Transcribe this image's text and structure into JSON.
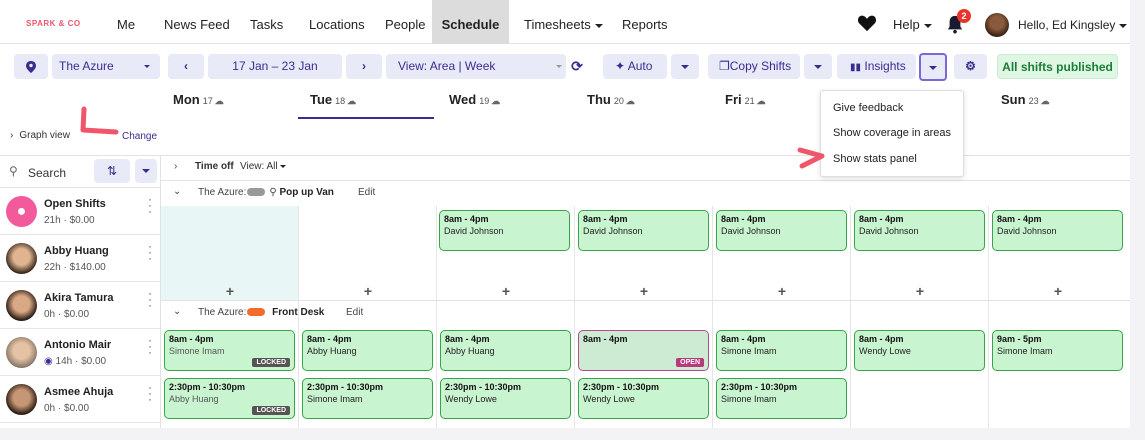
{
  "brand": "SPARK & CO",
  "nav": {
    "items": [
      "Me",
      "News Feed",
      "Tasks",
      "Locations",
      "People",
      "Schedule",
      "Timesheets",
      "Reports"
    ],
    "help": "Help",
    "notifications_count": "2",
    "greeting": "Hello, Ed Kingsley"
  },
  "toolbar": {
    "location": "The Azure",
    "date_range": "17 Jan – 23 Jan",
    "view": "View: Area |  Week",
    "auto": "Auto",
    "copy_shifts": "Copy Shifts",
    "insights": "Insights",
    "published": "All shifts published"
  },
  "days": [
    {
      "name": "Mon",
      "num": "17"
    },
    {
      "name": "Tue",
      "num": "18"
    },
    {
      "name": "Wed",
      "num": "19"
    },
    {
      "name": "Thu",
      "num": "20"
    },
    {
      "name": "Fri",
      "num": "21"
    },
    {
      "name": "Sun",
      "num": "23"
    }
  ],
  "graph_view": {
    "label": "Graph view",
    "change": "Change"
  },
  "insights_menu": [
    "Give feedback",
    "Show coverage in areas",
    "Show stats panel"
  ],
  "sidebar": {
    "search": "Search",
    "people": [
      {
        "name": "Open Shifts",
        "meta": "21h · $0.00"
      },
      {
        "name": "Abby Huang",
        "meta": "22h · $140.00"
      },
      {
        "name": "Akira Tamura",
        "meta": "0h · $0.00"
      },
      {
        "name": "Antonio Mair",
        "meta": "14h · $0.00"
      },
      {
        "name": "Asmee Ahuja",
        "meta": "0h · $0.00"
      }
    ]
  },
  "schedule": {
    "time_off": "Time off",
    "view_all": "View: All",
    "areas": [
      {
        "prefix": "The Azure:",
        "name": "Pop up Van",
        "edit": "Edit",
        "color": "#999999"
      },
      {
        "prefix": "The Azure:",
        "name": "Front Desk",
        "edit": "Edit",
        "color": "#f26b2a"
      }
    ],
    "popup_shifts": [
      {
        "time": "8am - 4pm",
        "who": "David Johnson"
      },
      {
        "time": "8am - 4pm",
        "who": "David Johnson"
      },
      {
        "time": "8am - 4pm",
        "who": "David Johnson"
      },
      {
        "time": "8am - 4pm",
        "who": "David Johnson"
      },
      {
        "time": "8am - 4pm",
        "who": "David Johnson"
      }
    ],
    "front_row1": [
      {
        "time": "8am - 4pm",
        "who": "Simone Imam",
        "tag": "LOCKED"
      },
      {
        "time": "8am - 4pm",
        "who": "Abby Huang"
      },
      {
        "time": "8am - 4pm",
        "who": "Abby Huang"
      },
      {
        "time": "8am - 4pm",
        "who": "",
        "tag": "OPEN"
      },
      {
        "time": "8am - 4pm",
        "who": "Simone Imam"
      },
      {
        "time": "8am - 4pm",
        "who": "Wendy Lowe"
      },
      {
        "time": "9am - 5pm",
        "who": "Simone Imam"
      }
    ],
    "front_row2": [
      {
        "time": "2:30pm - 10:30pm",
        "who": "Abby Huang",
        "tag": "LOCKED"
      },
      {
        "time": "2:30pm - 10:30pm",
        "who": "Simone Imam"
      },
      {
        "time": "2:30pm - 10:30pm",
        "who": "Wendy Lowe"
      },
      {
        "time": "2:30pm - 10:30pm",
        "who": "Wendy Lowe"
      },
      {
        "time": "2:30pm - 10:30pm",
        "who": "Simone Imam"
      }
    ]
  }
}
